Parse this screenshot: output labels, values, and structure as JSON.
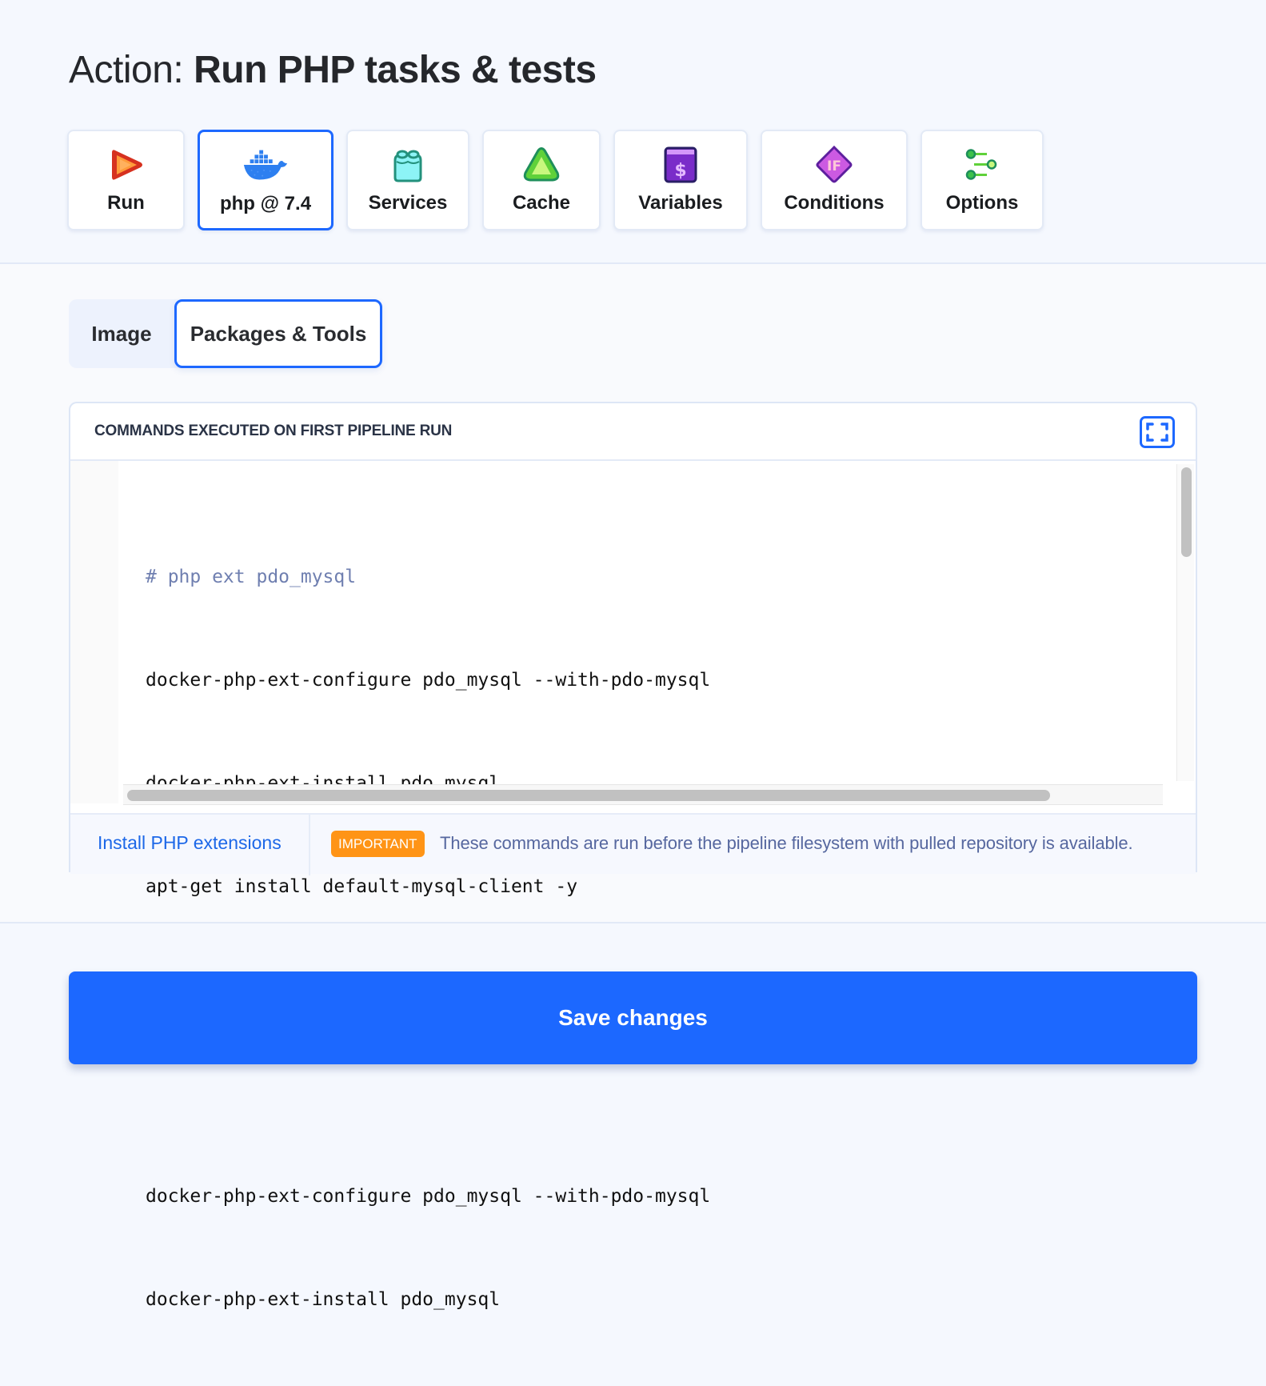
{
  "header": {
    "title_prefix": "Action:",
    "title_name": "Run PHP tasks & tests"
  },
  "nav_tiles": [
    {
      "label": "Run",
      "icon": "play-icon",
      "active": false
    },
    {
      "label": "php @ 7.4",
      "icon": "docker-whale-icon",
      "active": true
    },
    {
      "label": "Services",
      "icon": "lego-brick-icon",
      "active": false
    },
    {
      "label": "Cache",
      "icon": "cache-triangle-icon",
      "active": false
    },
    {
      "label": "Variables",
      "icon": "dollar-book-icon",
      "active": false
    },
    {
      "label": "Conditions",
      "icon": "if-diamond-icon",
      "active": false
    },
    {
      "label": "Options",
      "icon": "sliders-icon",
      "active": false
    }
  ],
  "sub_tabs": [
    {
      "label": "Image",
      "active": false
    },
    {
      "label": "Packages & Tools",
      "active": true
    }
  ],
  "commands_panel": {
    "title": "COMMANDS EXECUTED ON FIRST PIPELINE RUN",
    "fullscreen_icon": "fullscreen-icon",
    "code_lines": [
      {
        "text": "# php ext pdo_mysql",
        "type": "comment"
      },
      {
        "text": "docker-php-ext-configure pdo_mysql --with-pdo-mysql",
        "type": "command"
      },
      {
        "text": "docker-php-ext-install pdo_mysql",
        "type": "command"
      },
      {
        "text": "apt-get install default-mysql-client -y",
        "type": "command"
      },
      {
        "text": "",
        "type": "blank"
      },
      {
        "text": "# php ext pdo_mysql",
        "type": "comment"
      },
      {
        "text": "docker-php-ext-configure pdo_mysql --with-pdo-mysql",
        "type": "command"
      },
      {
        "text": "docker-php-ext-install pdo_mysql",
        "type": "command"
      }
    ],
    "footer": {
      "link_label": "Install PHP extensions",
      "badge": "IMPORTANT",
      "note": "These commands are run before the pipeline filesystem with pulled repository is available."
    }
  },
  "save_button": {
    "label": "Save changes"
  },
  "colors": {
    "accent": "#1d68ff",
    "badge": "#ff9416",
    "note_text": "#56679f",
    "comment": "#6f7fb0"
  }
}
